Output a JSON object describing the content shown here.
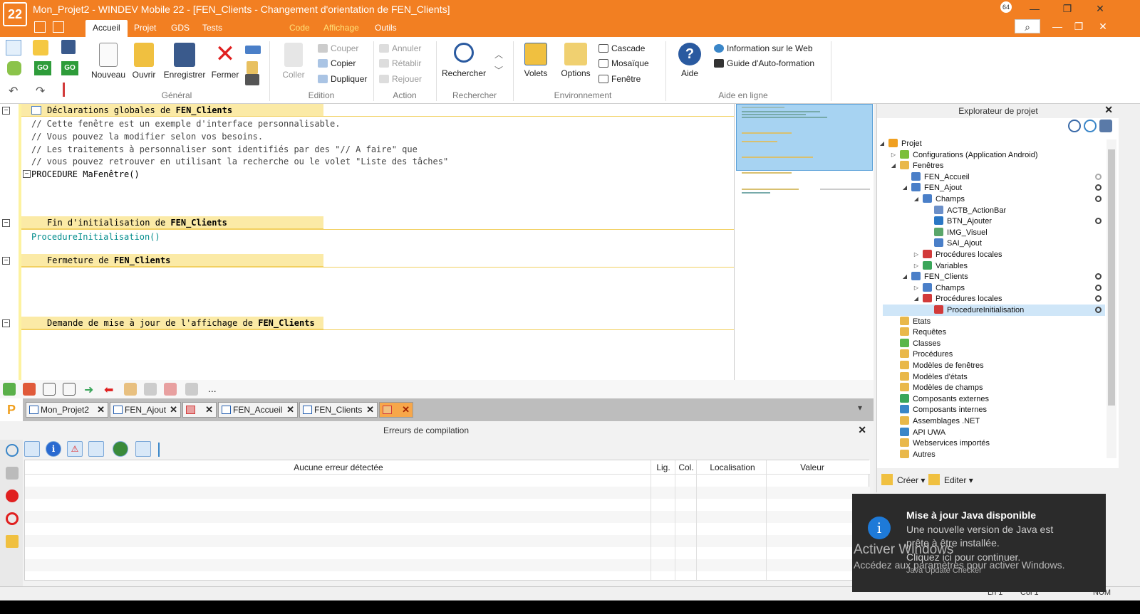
{
  "window": {
    "logo": "22",
    "title": "Mon_Projet2 - WINDEV Mobile 22 - [FEN_Clients - Changement d'orientation de FEN_Clients]",
    "bitness": "64",
    "controls": {
      "minimize": "—",
      "maximize": "❐",
      "close": "✕",
      "search": "⌕",
      "restore": "❐"
    }
  },
  "menu_tabs": [
    "Accueil",
    "Projet",
    "GDS",
    "Tests automatiques",
    "Code",
    "Affichage",
    "Outils"
  ],
  "ribbon": {
    "groups": {
      "general": "Général",
      "edition": "Edition",
      "action": "Action",
      "rechercher": "Rechercher",
      "environnement": "Environnement",
      "aide": "Aide en ligne"
    },
    "buttons": {
      "nouveau": "Nouveau",
      "ouvrir": "Ouvrir",
      "enregistrer": "Enregistrer",
      "fermer": "Fermer",
      "coller": "Coller",
      "rechercher": "Rechercher",
      "volets": "Volets",
      "options": "Options",
      "aide": "Aide"
    },
    "small": {
      "couper": "Couper",
      "copier": "Copier",
      "dupliquer": "Dupliquer",
      "annuler": "Annuler",
      "retablir": "Rétablir",
      "rejouer": "Rejouer",
      "cascade": "Cascade",
      "mosaique": "Mosaïque",
      "fenetre": "Fenêtre",
      "info_web": "Information sur le Web",
      "guide": "Guide d'Auto-formation"
    }
  },
  "editor": {
    "sections": [
      {
        "prefix": "Déclarations globales de ",
        "name": "FEN_Clients"
      },
      {
        "prefix": "Fin d'initialisation de ",
        "name": "FEN_Clients"
      },
      {
        "prefix": "Fermeture de ",
        "name": "FEN_Clients"
      },
      {
        "prefix": "Demande de mise à jour de l'affichage de ",
        "name": "FEN_Clients"
      }
    ],
    "comments": [
      "// Cette fenêtre est un exemple d'interface personnalisable.",
      "// Vous pouvez la modifier selon vos besoins.",
      "// Les traitements à personnaliser sont identifiés par des \"// A faire\" que",
      "// vous pouvez retrouver en utilisant la recherche ou le volet \"Liste des tâches\""
    ],
    "procedure_line": "PROCEDURE MaFenêtre()",
    "init_call": "ProcedureInitialisation()"
  },
  "more_tools": "...",
  "doc_tabs": [
    "Mon_Projet2",
    "FEN_Ajout",
    "",
    "FEN_Accueil",
    "FEN_Clients",
    ""
  ],
  "doc_tabs_menu": "▾",
  "errors": {
    "title": "Erreurs de compilation",
    "columns": {
      "main": "Aucune erreur détectée",
      "lig": "Lig.",
      "col": "Col.",
      "loc": "Localisation",
      "val": "Valeur"
    }
  },
  "explorer": {
    "title": "Explorateur de projet",
    "create": "Créer",
    "edit": "Editer",
    "tree": [
      {
        "label": "Projet",
        "level": 0,
        "arrow": "◢",
        "icon": "#f0a020",
        "status": false
      },
      {
        "label": "Configurations (Application Android)",
        "level": 1,
        "arrow": "▷",
        "icon": "#7cbf3a",
        "status": false
      },
      {
        "label": "Fenêtres",
        "level": 1,
        "arrow": "◢",
        "icon": "#e9b84a",
        "status": false
      },
      {
        "label": "FEN_Accueil",
        "level": 2,
        "arrow": "",
        "icon": "#4a7fc8",
        "status": "half"
      },
      {
        "label": "FEN_Ajout",
        "level": 2,
        "arrow": "◢",
        "icon": "#4a7fc8",
        "status": true
      },
      {
        "label": "Champs",
        "level": 3,
        "arrow": "◢",
        "icon": "#4a7fc8",
        "status": true
      },
      {
        "label": "ACTB_ActionBar",
        "level": 4,
        "arrow": "",
        "icon": "#6b8fc8",
        "status": false
      },
      {
        "label": "BTN_Ajouter",
        "level": 4,
        "arrow": "",
        "icon": "#2a77c4",
        "status": true
      },
      {
        "label": "IMG_Visuel",
        "level": 4,
        "arrow": "",
        "icon": "#5aa66a",
        "status": false
      },
      {
        "label": "SAI_Ajout",
        "level": 4,
        "arrow": "",
        "icon": "#4a7fc8",
        "status": false
      },
      {
        "label": "Procédures locales",
        "level": 3,
        "arrow": "▷",
        "icon": "#d23a3a",
        "status": false
      },
      {
        "label": "Variables",
        "level": 3,
        "arrow": "▷",
        "icon": "#3aa65a",
        "status": false
      },
      {
        "label": "FEN_Clients",
        "level": 2,
        "arrow": "◢",
        "icon": "#4a7fc8",
        "status": true
      },
      {
        "label": "Champs",
        "level": 3,
        "arrow": "▷",
        "icon": "#4a7fc8",
        "status": true
      },
      {
        "label": "Procédures locales",
        "level": 3,
        "arrow": "◢",
        "icon": "#d23a3a",
        "status": true
      },
      {
        "label": "ProcedureInitialisation",
        "level": 4,
        "arrow": "",
        "icon": "#d23a3a",
        "status": true
      },
      {
        "label": "Etats",
        "level": 1,
        "arrow": "",
        "icon": "#e9b84a",
        "status": false
      },
      {
        "label": "Requêtes",
        "level": 1,
        "arrow": "",
        "icon": "#e9b84a",
        "status": false
      },
      {
        "label": "Classes",
        "level": 1,
        "arrow": "",
        "icon": "#5ab64a",
        "status": false
      },
      {
        "label": "Procédures",
        "level": 1,
        "arrow": "",
        "icon": "#e9b84a",
        "status": false
      },
      {
        "label": "Modèles de fenêtres",
        "level": 1,
        "arrow": "",
        "icon": "#e9b84a",
        "status": false
      },
      {
        "label": "Modèles d'états",
        "level": 1,
        "arrow": "",
        "icon": "#e9b84a",
        "status": false
      },
      {
        "label": "Modèles de champs",
        "level": 1,
        "arrow": "",
        "icon": "#e9b84a",
        "status": false
      },
      {
        "label": "Composants externes",
        "level": 1,
        "arrow": "",
        "icon": "#3aa65a",
        "status": false
      },
      {
        "label": "Composants internes",
        "level": 1,
        "arrow": "",
        "icon": "#3a86c8",
        "status": false
      },
      {
        "label": "Assemblages .NET",
        "level": 1,
        "arrow": "",
        "icon": "#e9b84a",
        "status": false
      },
      {
        "label": "API UWA",
        "level": 1,
        "arrow": "",
        "icon": "#3a86c8",
        "status": false
      },
      {
        "label": "Webservices importés",
        "level": 1,
        "arrow": "",
        "icon": "#e9b84a",
        "status": false
      },
      {
        "label": "Autres",
        "level": 1,
        "arrow": "",
        "icon": "#e9b84a",
        "status": false
      }
    ]
  },
  "toast": {
    "title": "Mise à jour Java disponible",
    "line1": "Une nouvelle version de Java est",
    "line2": "prête à être installée.",
    "line3": "Cliquez ici pour continuer.",
    "source": "Java Update Checker"
  },
  "watermark": {
    "line1": "Activer Windows",
    "line2": "Accédez aux paramètres pour activer Windows."
  },
  "status": {
    "ln": "Ln 1",
    "col": "Col 1",
    "num": "NUM"
  }
}
